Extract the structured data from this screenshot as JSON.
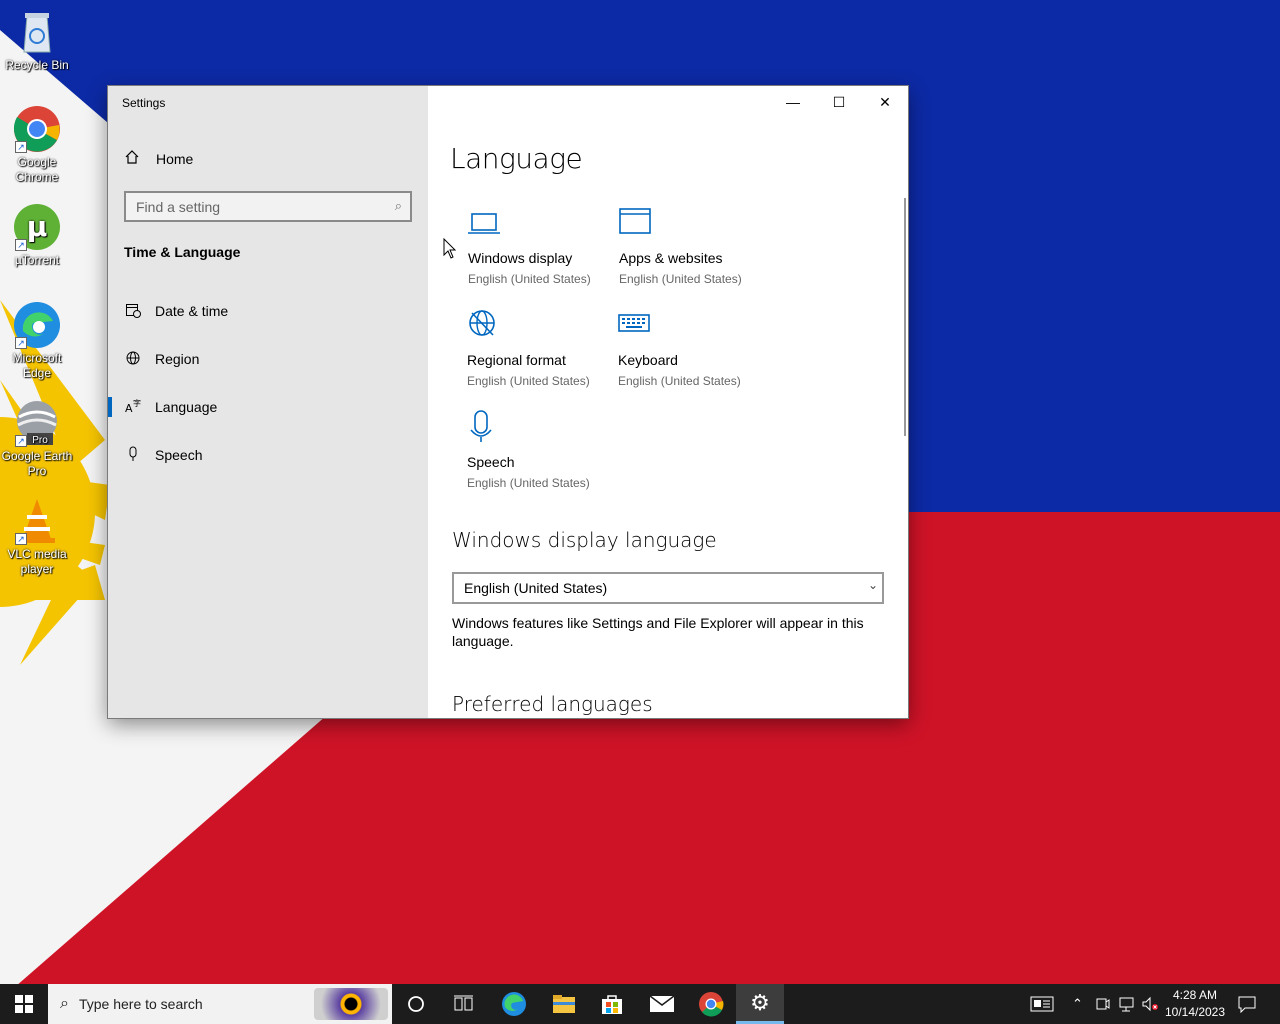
{
  "desktop": {
    "icons": [
      {
        "label": "Recycle Bin"
      },
      {
        "label": "Google Chrome"
      },
      {
        "label": "µTorrent"
      },
      {
        "label": "Microsoft Edge"
      },
      {
        "label": "Google Earth Pro",
        "badge": "Pro"
      },
      {
        "label": "VLC media player"
      }
    ]
  },
  "window": {
    "title": "Settings",
    "controls": {
      "minimize": "—",
      "maximize": "☐",
      "close": "✕"
    },
    "sidebar": {
      "home_label": "Home",
      "search_placeholder": "Find a setting",
      "section_title": "Time & Language",
      "items": [
        {
          "label": "Date & time"
        },
        {
          "label": "Region"
        },
        {
          "label": "Language"
        },
        {
          "label": "Speech"
        }
      ]
    },
    "main": {
      "title": "Language",
      "tiles": [
        {
          "name": "Windows display",
          "sub": "English (United States)"
        },
        {
          "name": "Apps & websites",
          "sub": "English (United States)"
        },
        {
          "name": "Regional format",
          "sub": "English (United States)"
        },
        {
          "name": "Keyboard",
          "sub": "English (United States)"
        },
        {
          "name": "Speech",
          "sub": "English (United States)"
        }
      ],
      "display_language_heading": "Windows display language",
      "display_language_value": "English (United States)",
      "display_language_desc": "Windows features like Settings and File Explorer will appear in this language.",
      "preferred_heading": "Preferred languages"
    }
  },
  "taskbar": {
    "search_placeholder": "Type here to search",
    "clock_time": "4:28 AM",
    "clock_date": "10/14/2023"
  },
  "colors": {
    "accent": "#0067c0",
    "sidebar_bg": "#e6e6e6",
    "taskbar_bg": "#1c1c1c"
  }
}
